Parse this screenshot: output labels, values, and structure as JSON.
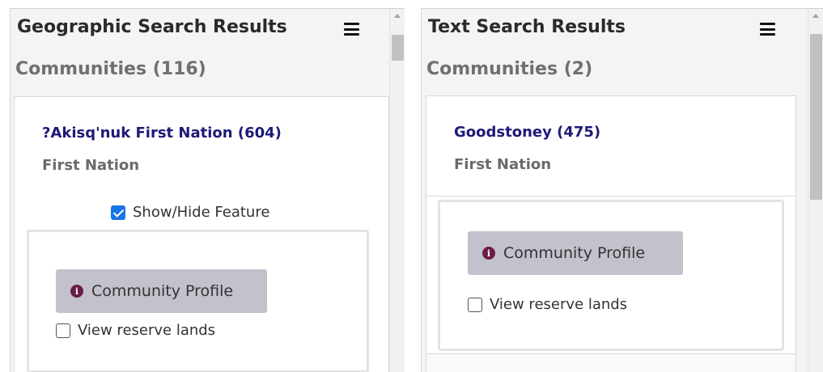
{
  "left_panel": {
    "title": "Geographic Search Results",
    "section_title": "Communities (116)",
    "community": {
      "name": "?Akisq'nuk First Nation (604)",
      "type": "First Nation"
    },
    "show_hide": {
      "label": "Show/Hide Feature",
      "checked": true
    },
    "profile_button_label": "Community Profile",
    "reserve_lands": {
      "label": "View reserve lands",
      "checked": false
    },
    "icons": [
      "hamburger-menu-icon",
      "info-icon",
      "scroll-up-arrow-icon"
    ]
  },
  "right_panel": {
    "title": "Text Search Results",
    "section_title": "Communities (2)",
    "community": {
      "name": "Goodstoney (475)",
      "type": "First Nation"
    },
    "profile_button_label": "Community Profile",
    "reserve_lands": {
      "label": "View reserve lands",
      "checked": false
    },
    "icons": [
      "hamburger-menu-icon",
      "info-icon",
      "scroll-up-arrow-icon"
    ]
  },
  "colors": {
    "community_link": "#1d1a78",
    "info_icon": "#6b1c47",
    "profile_button_bg": "#c3c1cc",
    "checkbox_checked": "#1a73e8"
  }
}
